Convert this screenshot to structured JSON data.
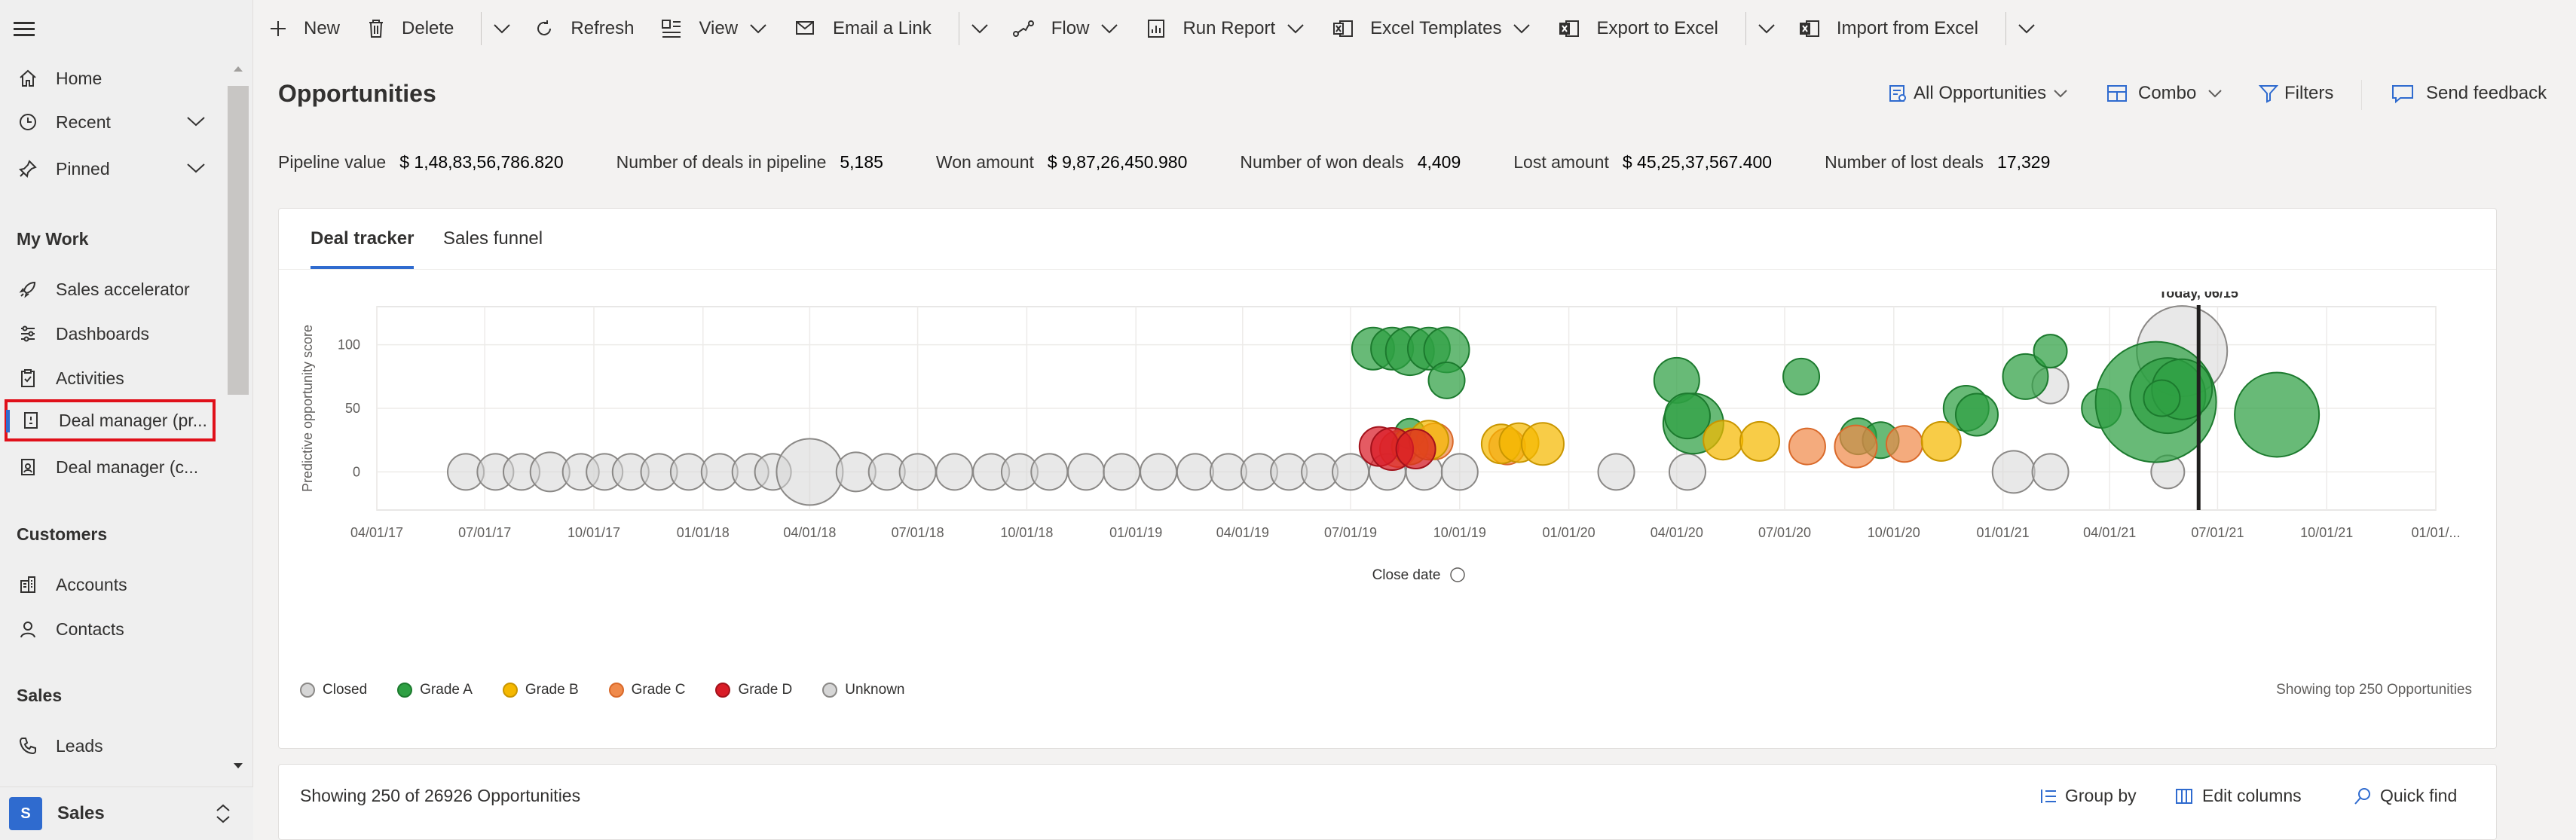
{
  "sidebar": {
    "items": [
      {
        "label": "Home",
        "icon": "home-icon"
      },
      {
        "label": "Recent",
        "icon": "clock-icon"
      },
      {
        "label": "Pinned",
        "icon": "pin-icon"
      }
    ],
    "sections": [
      {
        "title": "My Work",
        "items": [
          {
            "label": "Sales accelerator",
            "icon": "rocket-icon"
          },
          {
            "label": "Dashboards",
            "icon": "dashboard-icon"
          },
          {
            "label": "Activities",
            "icon": "clipboard-icon"
          },
          {
            "label": "Deal manager (pr...",
            "icon": "deal-icon",
            "selected": true
          },
          {
            "label": "Deal manager (c...",
            "icon": "deal-classic-icon"
          }
        ]
      },
      {
        "title": "Customers",
        "items": [
          {
            "label": "Accounts",
            "icon": "building-icon"
          },
          {
            "label": "Contacts",
            "icon": "person-icon"
          }
        ]
      },
      {
        "title": "Sales",
        "items": [
          {
            "label": "Leads",
            "icon": "phone-icon"
          }
        ]
      }
    ],
    "area": {
      "badge": "S",
      "label": "Sales"
    }
  },
  "commands": {
    "new": "New",
    "delete": "Delete",
    "refresh": "Refresh",
    "view": "View",
    "email_link": "Email a Link",
    "flow": "Flow",
    "run_report": "Run Report",
    "excel_templates": "Excel Templates",
    "export_excel": "Export to Excel",
    "import_excel": "Import from Excel"
  },
  "page": {
    "title": "Opportunities",
    "view_selector": "All Opportunities",
    "chart_mode": "Combo",
    "filters": "Filters",
    "send_feedback": "Send feedback"
  },
  "metrics": [
    {
      "label": "Pipeline value",
      "value": "$ 1,48,83,56,786.820"
    },
    {
      "label": "Number of deals in pipeline",
      "value": "5,185"
    },
    {
      "label": "Won amount",
      "value": "$ 9,87,26,450.980"
    },
    {
      "label": "Number of won deals",
      "value": "4,409"
    },
    {
      "label": "Lost amount",
      "value": "$ 45,25,37,567.400"
    },
    {
      "label": "Number of lost deals",
      "value": "17,329"
    }
  ],
  "tabs": {
    "deal_tracker": "Deal tracker",
    "sales_funnel": "Sales funnel"
  },
  "chart_data": {
    "type": "scatter",
    "xlabel": "Close date",
    "ylabel": "Predictive opportunity score",
    "x_ticks": [
      "04/01/17",
      "07/01/17",
      "10/01/17",
      "01/01/18",
      "04/01/18",
      "07/01/18",
      "10/01/18",
      "01/01/19",
      "04/01/19",
      "07/01/19",
      "10/01/19",
      "01/01/20",
      "04/01/20",
      "07/01/20",
      "10/01/20",
      "01/01/21",
      "04/01/21",
      "07/01/21",
      "10/01/21",
      "01/01/..."
    ],
    "y_ticks": [
      "100",
      "50",
      "0"
    ],
    "ylim": [
      -30,
      130
    ],
    "grid": true,
    "today_marker": {
      "label": "Today, 06/15",
      "x": "2021-06-15"
    },
    "colors": {
      "Closed": "#d6d6d6",
      "Grade A": "#2ea043",
      "Grade B": "#f5b800",
      "Grade C": "#f08a4b",
      "Grade D": "#d91c27",
      "Unknown": "#d6d6d6"
    },
    "series": [
      {
        "name": "Grade A",
        "points": [
          {
            "x": "2019-07-20",
            "y": 97,
            "r": 14
          },
          {
            "x": "2019-08-05",
            "y": 97,
            "r": 14
          },
          {
            "x": "2019-08-20",
            "y": 95,
            "r": 16
          },
          {
            "x": "2019-09-05",
            "y": 97,
            "r": 14
          },
          {
            "x": "2019-09-20",
            "y": 96,
            "r": 15
          },
          {
            "x": "2019-09-20",
            "y": 72,
            "r": 12
          },
          {
            "x": "2019-08-20",
            "y": 30,
            "r": 10
          },
          {
            "x": "2020-04-01",
            "y": 72,
            "r": 15
          },
          {
            "x": "2020-04-15",
            "y": 38,
            "r": 20
          },
          {
            "x": "2020-04-10",
            "y": 44,
            "r": 15
          },
          {
            "x": "2020-07-15",
            "y": 75,
            "r": 12
          },
          {
            "x": "2020-09-01",
            "y": 28,
            "r": 12
          },
          {
            "x": "2020-09-20",
            "y": 25,
            "r": 12
          },
          {
            "x": "2020-12-01",
            "y": 50,
            "r": 15
          },
          {
            "x": "2020-12-10",
            "y": 45,
            "r": 14
          },
          {
            "x": "2021-01-20",
            "y": 75,
            "r": 15
          },
          {
            "x": "2021-02-10",
            "y": 95,
            "r": 11
          },
          {
            "x": "2021-03-25",
            "y": 50,
            "r": 13
          },
          {
            "x": "2021-05-10",
            "y": 55,
            "r": 40
          },
          {
            "x": "2021-05-20",
            "y": 60,
            "r": 25
          },
          {
            "x": "2021-06-01",
            "y": 65,
            "r": 20
          },
          {
            "x": "2021-05-15",
            "y": 58,
            "r": 12
          },
          {
            "x": "2021-08-20",
            "y": 45,
            "r": 28
          }
        ]
      },
      {
        "name": "Grade B",
        "points": [
          {
            "x": "2019-08-20",
            "y": 20,
            "r": 12
          },
          {
            "x": "2019-09-05",
            "y": 25,
            "r": 13
          },
          {
            "x": "2019-11-05",
            "y": 22,
            "r": 13
          },
          {
            "x": "2019-11-20",
            "y": 23,
            "r": 13
          },
          {
            "x": "2019-12-10",
            "y": 22,
            "r": 14
          },
          {
            "x": "2020-05-10",
            "y": 25,
            "r": 13
          },
          {
            "x": "2020-06-10",
            "y": 24,
            "r": 13
          },
          {
            "x": "2020-11-10",
            "y": 24,
            "r": 13
          }
        ]
      },
      {
        "name": "Grade C",
        "points": [
          {
            "x": "2019-08-10",
            "y": 18,
            "r": 12
          },
          {
            "x": "2019-09-10",
            "y": 24,
            "r": 12
          },
          {
            "x": "2019-11-10",
            "y": 20,
            "r": 12
          },
          {
            "x": "2020-07-20",
            "y": 20,
            "r": 12
          },
          {
            "x": "2020-08-30",
            "y": 20,
            "r": 14
          },
          {
            "x": "2020-10-10",
            "y": 22,
            "r": 12
          }
        ]
      },
      {
        "name": "Grade D",
        "points": [
          {
            "x": "2019-07-25",
            "y": 20,
            "r": 13
          },
          {
            "x": "2019-08-05",
            "y": 18,
            "r": 14
          },
          {
            "x": "2019-08-25",
            "y": 18,
            "r": 13
          }
        ]
      },
      {
        "name": "Closed",
        "points": [
          {
            "x": "2017-06-15",
            "y": 0,
            "r": 12
          },
          {
            "x": "2017-07-10",
            "y": 0,
            "r": 12
          },
          {
            "x": "2017-08-01",
            "y": 0,
            "r": 12
          },
          {
            "x": "2017-08-25",
            "y": 0,
            "r": 13
          },
          {
            "x": "2017-09-20",
            "y": 0,
            "r": 12
          },
          {
            "x": "2017-10-10",
            "y": 0,
            "r": 12
          },
          {
            "x": "2017-11-01",
            "y": 0,
            "r": 12
          },
          {
            "x": "2017-11-25",
            "y": 0,
            "r": 12
          },
          {
            "x": "2017-12-20",
            "y": 0,
            "r": 12
          },
          {
            "x": "2018-01-15",
            "y": 0,
            "r": 12
          },
          {
            "x": "2018-02-10",
            "y": 0,
            "r": 12
          },
          {
            "x": "2018-03-01",
            "y": 0,
            "r": 12
          },
          {
            "x": "2018-04-01",
            "y": 0,
            "r": 22
          },
          {
            "x": "2018-05-10",
            "y": 0,
            "r": 13
          },
          {
            "x": "2018-06-05",
            "y": 0,
            "r": 12
          },
          {
            "x": "2018-07-01",
            "y": 0,
            "r": 12
          },
          {
            "x": "2018-08-01",
            "y": 0,
            "r": 12
          },
          {
            "x": "2018-09-01",
            "y": 0,
            "r": 12
          },
          {
            "x": "2018-09-25",
            "y": 0,
            "r": 12
          },
          {
            "x": "2018-10-20",
            "y": 0,
            "r": 12
          },
          {
            "x": "2018-11-20",
            "y": 0,
            "r": 12
          },
          {
            "x": "2018-12-20",
            "y": 0,
            "r": 12
          },
          {
            "x": "2019-01-20",
            "y": 0,
            "r": 12
          },
          {
            "x": "2019-02-20",
            "y": 0,
            "r": 12
          },
          {
            "x": "2019-03-20",
            "y": 0,
            "r": 12
          },
          {
            "x": "2019-04-15",
            "y": 0,
            "r": 12
          },
          {
            "x": "2019-05-10",
            "y": 0,
            "r": 12
          },
          {
            "x": "2019-06-05",
            "y": 0,
            "r": 12
          },
          {
            "x": "2019-07-01",
            "y": 0,
            "r": 12
          },
          {
            "x": "2019-08-01",
            "y": 0,
            "r": 12
          },
          {
            "x": "2019-09-01",
            "y": 0,
            "r": 12
          },
          {
            "x": "2019-10-01",
            "y": 0,
            "r": 12
          },
          {
            "x": "2020-02-10",
            "y": 0,
            "r": 12
          },
          {
            "x": "2020-04-10",
            "y": 0,
            "r": 12
          },
          {
            "x": "2021-01-10",
            "y": 0,
            "r": 14
          },
          {
            "x": "2021-02-10",
            "y": 0,
            "r": 12
          },
          {
            "x": "2021-05-20",
            "y": 0,
            "r": 11
          }
        ]
      },
      {
        "name": "Unknown",
        "points": [
          {
            "x": "2021-02-10",
            "y": 68,
            "r": 12
          },
          {
            "x": "2021-06-01",
            "y": 95,
            "r": 30
          }
        ]
      }
    ]
  },
  "legend": [
    "Closed",
    "Grade A",
    "Grade B",
    "Grade C",
    "Grade D",
    "Unknown"
  ],
  "showing_top": "Showing top 250 Opportunities",
  "grid": {
    "count": "Showing 250 of 26926 Opportunities",
    "group_by": "Group by",
    "edit_columns": "Edit columns",
    "quick_find": "Quick find"
  }
}
